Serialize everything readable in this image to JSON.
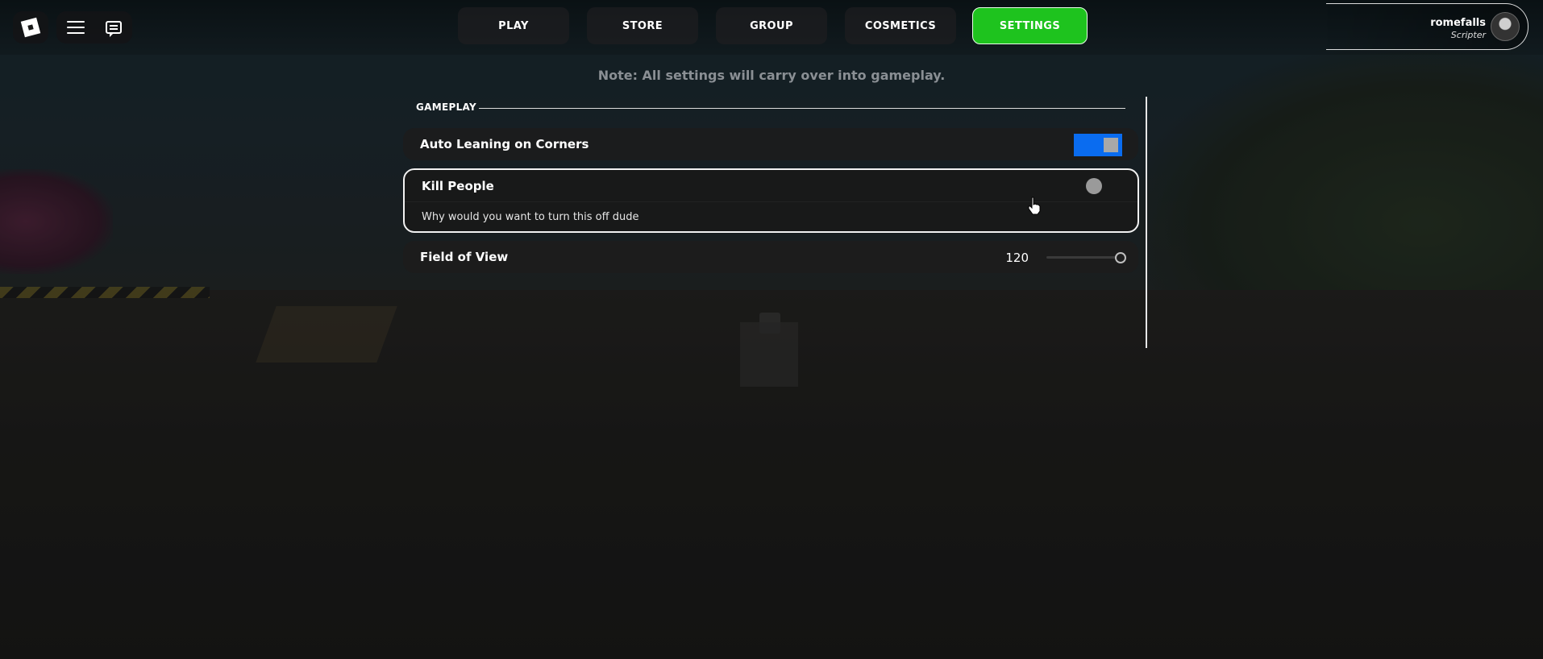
{
  "topbar": {
    "nav": [
      "PLAY",
      "STORE",
      "GROUP",
      "COSMETICS",
      "SETTINGS"
    ],
    "active": "SETTINGS",
    "user": {
      "name": "romefalls",
      "role": "Scripter"
    }
  },
  "settings": {
    "note": "Note: All settings will carry over into gameplay.",
    "section": "GAMEPLAY",
    "items": [
      {
        "label": "Auto Leaning on Corners",
        "type": "toggle",
        "enabled": true
      },
      {
        "label": "Kill People",
        "type": "toggle",
        "enabled": false,
        "description": "Why would you want to turn this off dude"
      },
      {
        "label": "Field of View",
        "type": "slider",
        "value": "120",
        "level": 1.0
      }
    ]
  },
  "colors": {
    "active_nav": "#1ec31e",
    "toggle_on": "#0a6cf0"
  },
  "icons": [
    "roblox-logo-icon",
    "hamburger-menu-icon",
    "chat-icon",
    "avatar",
    "cursor-icon"
  ]
}
